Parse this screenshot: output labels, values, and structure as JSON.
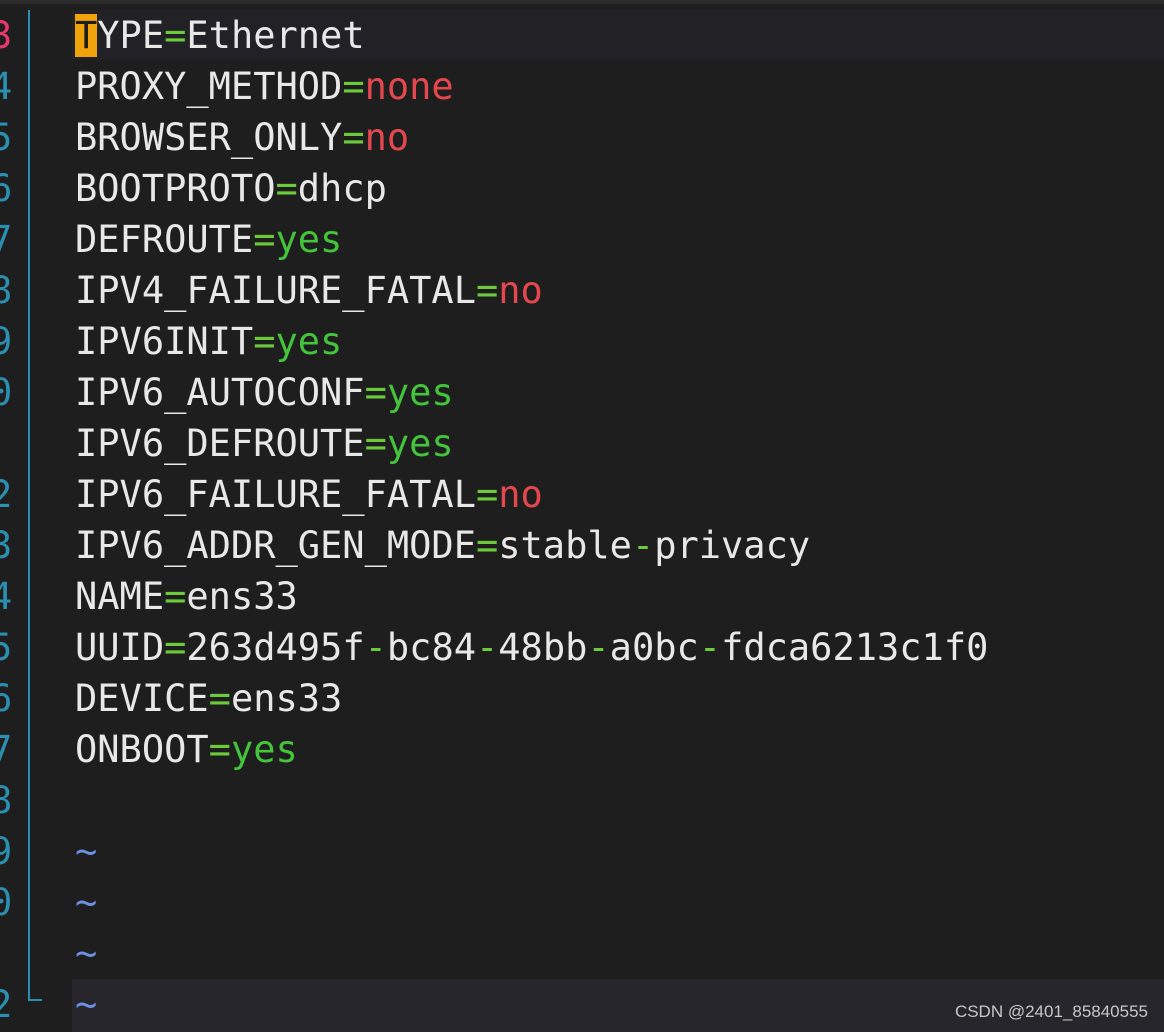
{
  "editor": {
    "gutter_numbers": [
      "3",
      "4",
      "5",
      "6",
      "7",
      "8",
      "9",
      "0",
      "",
      "2",
      "3",
      "4",
      "5",
      "6",
      "7",
      "8",
      "9",
      "0",
      "",
      "2"
    ],
    "lines": [
      {
        "type": "kv",
        "key": "TYPE",
        "value": "Ethernet",
        "value_color": "default",
        "cursor_char": "T",
        "key_rest": "YPE"
      },
      {
        "type": "kv",
        "key": "PROXY_METHOD",
        "value": "none",
        "value_color": "red"
      },
      {
        "type": "kv",
        "key": "BROWSER_ONLY",
        "value": "no",
        "value_color": "red"
      },
      {
        "type": "kv",
        "key": "BOOTPROTO",
        "value": "dhcp",
        "value_color": "default"
      },
      {
        "type": "kv",
        "key": "DEFROUTE",
        "value": "yes",
        "value_color": "green"
      },
      {
        "type": "kv",
        "key": "IPV4_FAILURE_FATAL",
        "value": "no",
        "value_color": "red"
      },
      {
        "type": "kv",
        "key": "IPV6INIT",
        "value": "yes",
        "value_color": "green"
      },
      {
        "type": "kv",
        "key": "IPV6_AUTOCONF",
        "value": "yes",
        "value_color": "green"
      },
      {
        "type": "kv",
        "key": "IPV6_DEFROUTE",
        "value": "yes",
        "value_color": "green"
      },
      {
        "type": "kv",
        "key": "IPV6_FAILURE_FATAL",
        "value": "no",
        "value_color": "red"
      },
      {
        "type": "kv",
        "key": "IPV6_ADDR_GEN_MODE",
        "value_parts": [
          "stable",
          "privacy"
        ],
        "value_color": "default"
      },
      {
        "type": "kv",
        "key": "NAME",
        "value": "ens33",
        "value_color": "default"
      },
      {
        "type": "kv",
        "key": "UUID",
        "value_parts": [
          "263d495f",
          "bc84",
          "48bb",
          "a0bc",
          "fdca6213c1f0"
        ],
        "value_color": "default"
      },
      {
        "type": "kv",
        "key": "DEVICE",
        "value": "ens33",
        "value_color": "default"
      },
      {
        "type": "kv",
        "key": "ONBOOT",
        "value": "yes",
        "value_color": "green"
      },
      {
        "type": "empty"
      },
      {
        "type": "tilde",
        "text": "~"
      },
      {
        "type": "tilde",
        "text": "~"
      },
      {
        "type": "tilde",
        "text": "~"
      },
      {
        "type": "tilde",
        "text": "~"
      }
    ],
    "equals_sign": "=",
    "dash": "-"
  },
  "colors": {
    "background": "#1e1e1e",
    "text": "#e8e8e8",
    "equals": "#6ccb3b",
    "value_red": "#e5474f",
    "value_green": "#43c43a",
    "line_number": "#2a8fb0",
    "current_line_number": "#e6386a",
    "cursor": "#f0a30a",
    "tilde": "#6d8fe4"
  },
  "watermark": {
    "text": "CSDN @2401_85840555"
  }
}
